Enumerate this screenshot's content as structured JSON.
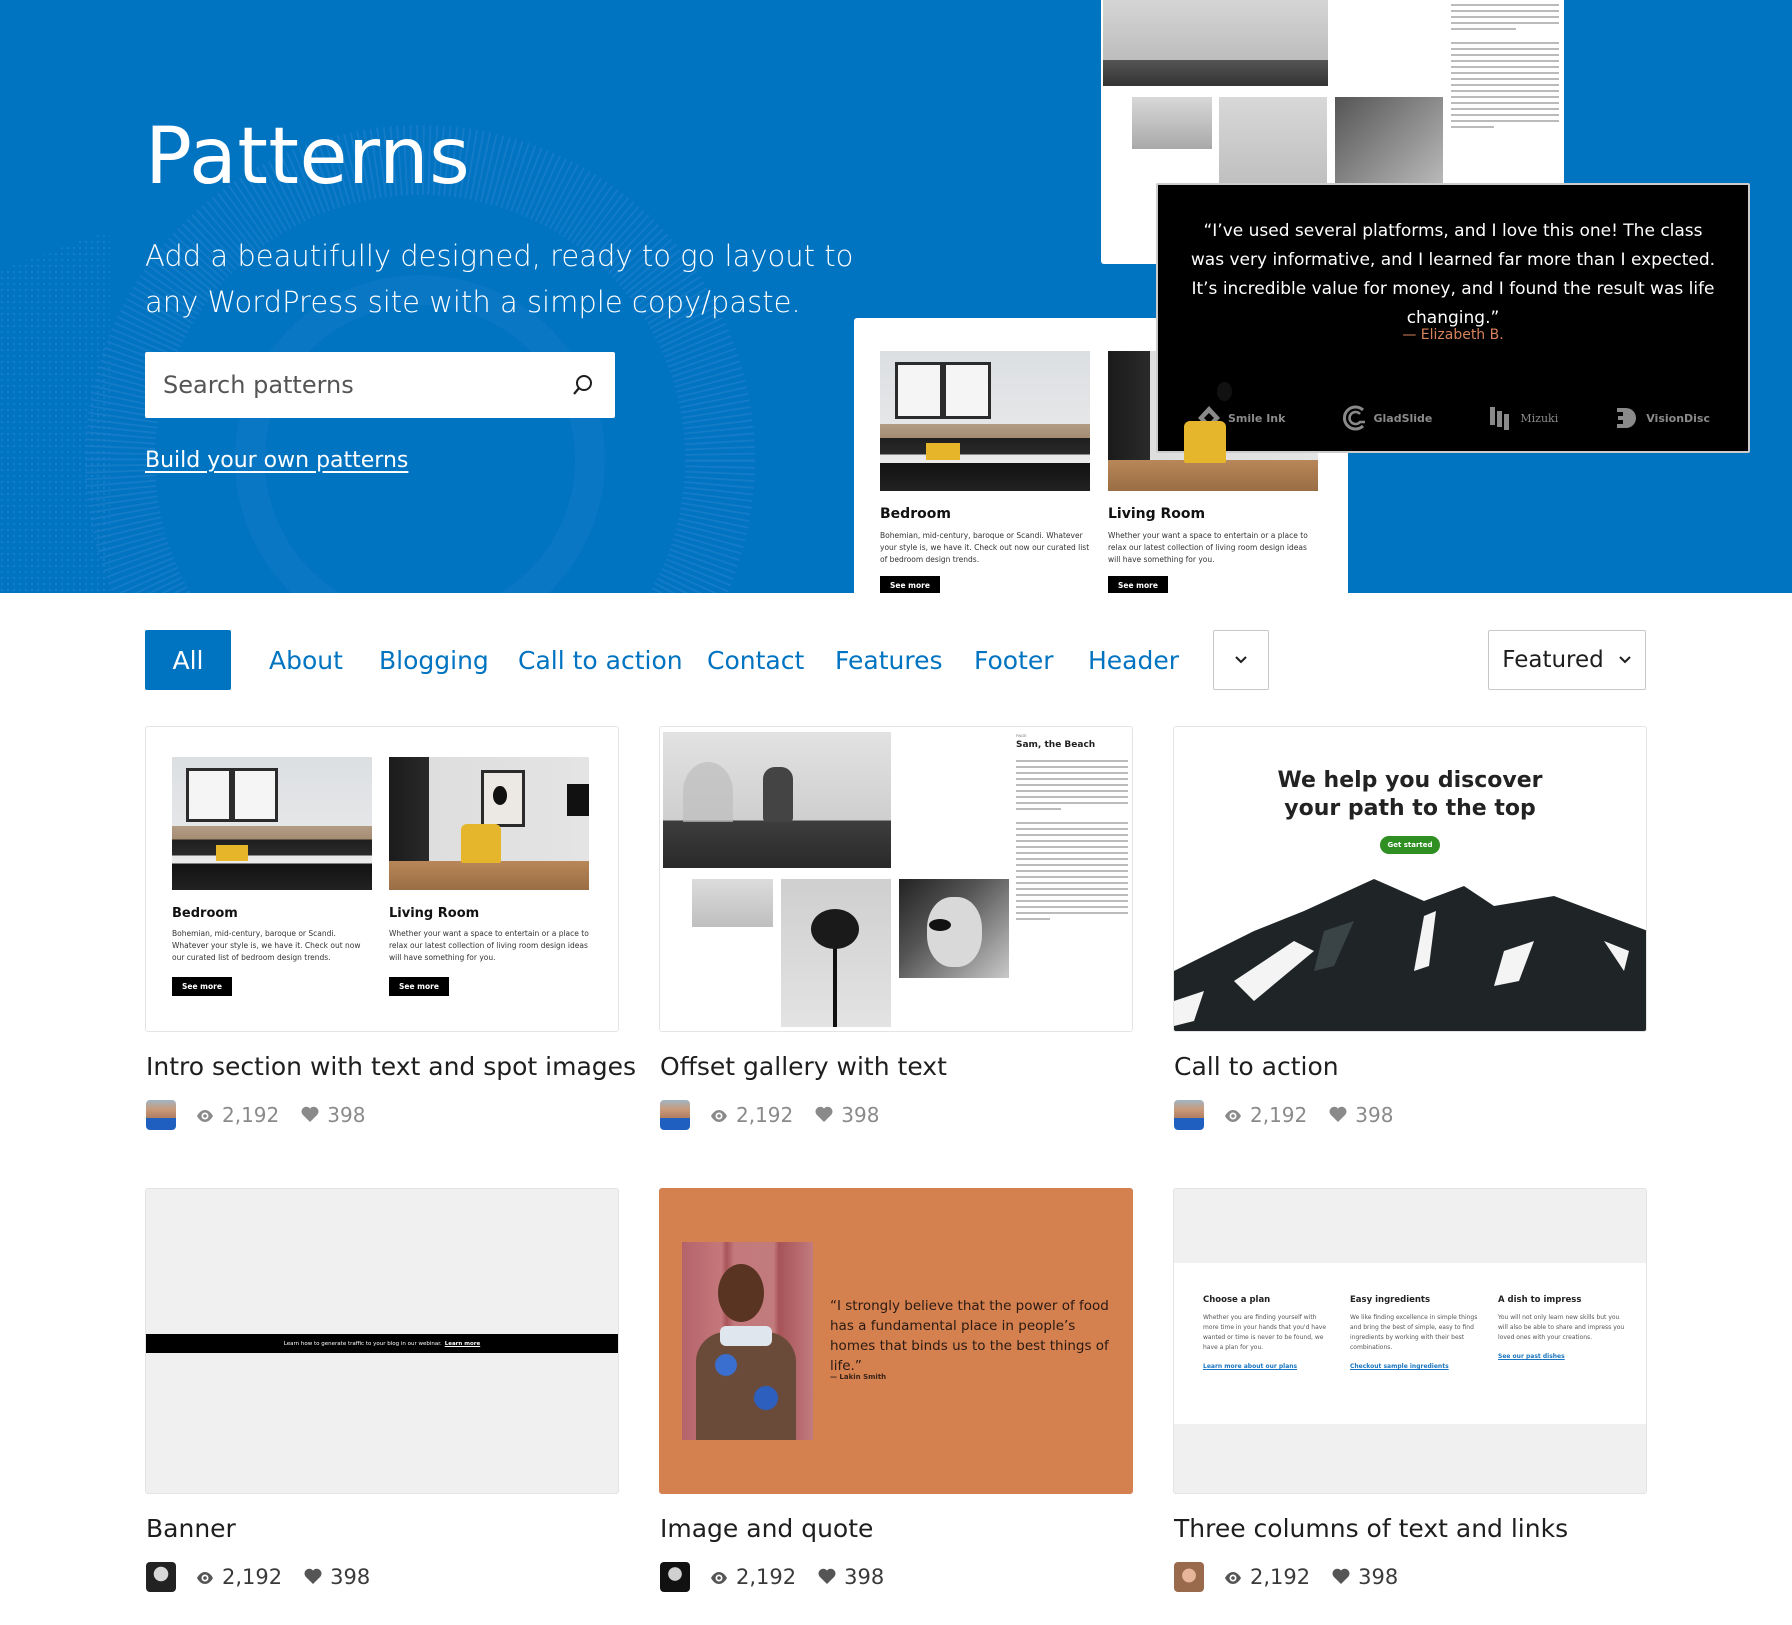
{
  "hero": {
    "title": "Patterns",
    "subtitle": "Add a beautifully designed, ready to go layout to any WordPress site with a simple copy/paste.",
    "search_placeholder": "Search patterns",
    "build_link": "Build your own patterns",
    "colors": {
      "background": "#0073c1",
      "text": "#ffffff"
    },
    "preview_quote": {
      "text": "“I’ve used several platforms, and I love this one! The class was very informative, and I learned far more than I expected. It’s incredible value for money, and I found the result was life changing.”",
      "author": "— Elizabeth B.",
      "logos": [
        "Smile Ink",
        "GladSlide",
        "Mizuki",
        "VisionDisc"
      ]
    },
    "preview_intro": {
      "columns": [
        {
          "heading": "Bedroom",
          "body": "Bohemian, mid-century, baroque or Scandi. Whatever your style is, we have it. Check out now our curated list of bedroom design trends.",
          "button": "See more"
        },
        {
          "heading": "Living Room",
          "body": "Whether your want a space to entertain or a place to relax our latest collection of living room design ideas will have something for you.",
          "button": "See more"
        }
      ]
    }
  },
  "filters": {
    "tabs": [
      {
        "label": "All",
        "active": true
      },
      {
        "label": "About",
        "active": false
      },
      {
        "label": "Blogging",
        "active": false
      },
      {
        "label": "Call to action",
        "active": false
      },
      {
        "label": "Contact",
        "active": false
      },
      {
        "label": "Features",
        "active": false
      },
      {
        "label": "Footer",
        "active": false
      },
      {
        "label": "Header",
        "active": false
      }
    ],
    "more_icon": "chevron-down-icon",
    "sort": {
      "selected": "Featured"
    }
  },
  "patterns": [
    {
      "title": "Intro section with text and spot images",
      "views": "2,192",
      "likes": "398",
      "preview": {
        "columns": [
          {
            "heading": "Bedroom",
            "body": "Bohemian, mid-century, baroque or Scandi. Whatever your style is, we have it. Check out now our curated list of bedroom design trends.",
            "button": "See more"
          },
          {
            "heading": "Living Room",
            "body": "Whether your want a space to entertain or a place to relax our latest collection of living room design ideas will have something for you.",
            "button": "See more"
          }
        ]
      }
    },
    {
      "title": "Offset gallery with text",
      "views": "2,192",
      "likes": "398",
      "preview": {
        "kicker": "PAGE",
        "heading": "Sam, the Beach"
      }
    },
    {
      "title": "Call to action",
      "views": "2,192",
      "likes": "398",
      "preview": {
        "heading": "We help you discover your path to the top",
        "button": "Get started",
        "button_color": "#2f8f22"
      }
    },
    {
      "title": "Banner",
      "views": "2,192",
      "likes": "398",
      "preview": {
        "text": "Learn how to generate traffic to your blog in our webinar.",
        "link": "Learn more"
      }
    },
    {
      "title": "Image and quote",
      "views": "2,192",
      "likes": "398",
      "preview": {
        "quote": "“I strongly believe that the power of food has a fundamental place in people’s homes that binds us to the best things of life.”",
        "cite": "— Lakin Smith",
        "background": "#d4804f"
      }
    },
    {
      "title": "Three columns of text and links",
      "views": "2,192",
      "likes": "398",
      "preview": {
        "columns": [
          {
            "heading": "Choose a plan",
            "body": "Whether you are finding yourself with more time in your hands that you'd have wanted or time is never to be found, we have a plan for you.",
            "link": "Learn more about our plans"
          },
          {
            "heading": "Easy ingredients",
            "body": "We like finding excellence in simple things and bring the best of simple, easy to find ingredients by working with their best combinations.",
            "link": "Checkout sample ingredients"
          },
          {
            "heading": "A dish to impress",
            "body": "You will not only learn new skills but you will also be able to share and impress you loved ones with your creations.",
            "link": "See our past dishes"
          }
        ]
      }
    }
  ]
}
